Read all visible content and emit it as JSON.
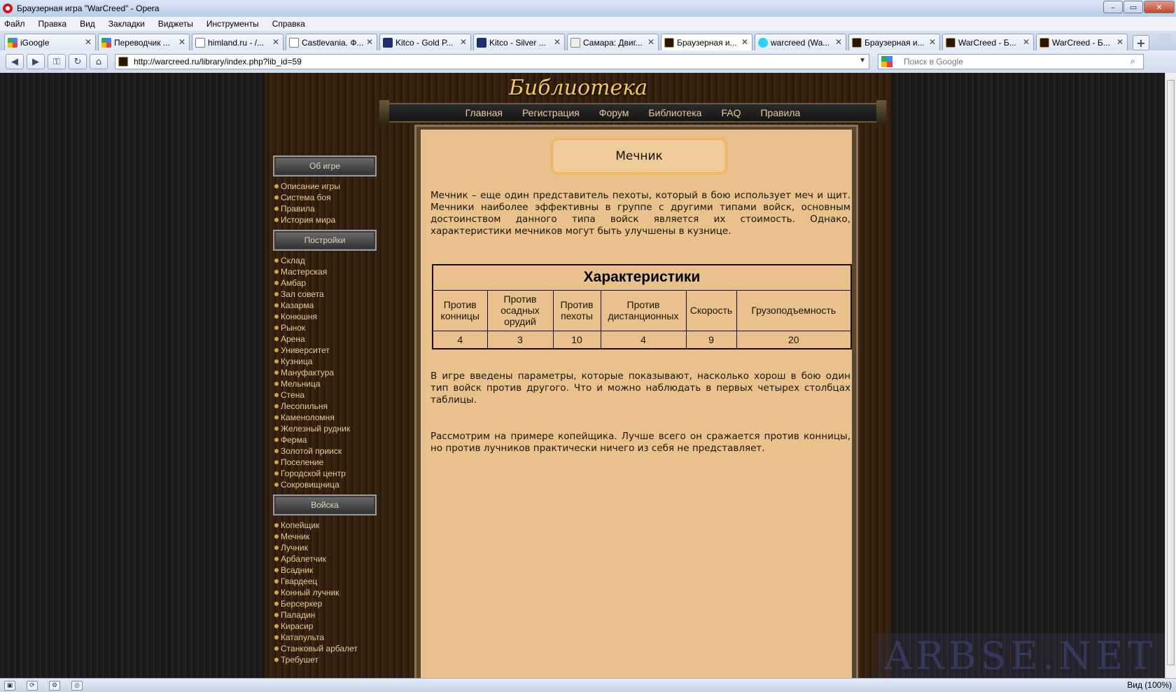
{
  "window": {
    "title": "Браузерная игра \"WarCreed\" - Opera",
    "controls": [
      "–",
      "▭",
      "✕"
    ]
  },
  "menu": [
    "Файл",
    "Правка",
    "Вид",
    "Закладки",
    "Виджеты",
    "Инструменты",
    "Справка"
  ],
  "tabs": [
    {
      "label": "iGoogle",
      "icon": "google-icon"
    },
    {
      "label": "Переводчик ...",
      "icon": "google-icon"
    },
    {
      "label": "himland.ru - /...",
      "icon": "page-icon"
    },
    {
      "label": "Castlevania. Ф...",
      "icon": "page-icon"
    },
    {
      "label": "Kitco - Gold P...",
      "icon": "kitco-icon"
    },
    {
      "label": "Kitco - Silver ...",
      "icon": "kitco-icon"
    },
    {
      "label": "Самара: Двиг...",
      "icon": "page-icon"
    },
    {
      "label": "Браузерная и...",
      "icon": "warcreed-icon",
      "active": true
    },
    {
      "label": "warcreed (Wa...",
      "icon": "twitter-icon"
    },
    {
      "label": "Браузерная и...",
      "icon": "warcreed-icon"
    },
    {
      "label": "WarCreed - Б...",
      "icon": "warcreed-icon"
    },
    {
      "label": "WarCreed - Б...",
      "icon": "warcreed-icon"
    }
  ],
  "address": {
    "url": "http://warcreed.ru/library/index.php?lib_id=59",
    "search_placeholder": "Поиск в Google"
  },
  "site": {
    "title": "Библиотека",
    "nav": [
      "Главная",
      "Регистрация",
      "Форум",
      "Библиотека",
      "FAQ",
      "Правила"
    ]
  },
  "sidebar": {
    "sections": [
      {
        "header": "Об игре",
        "items": [
          "Описание игры",
          "Система боя",
          "Правила",
          "История мира"
        ]
      },
      {
        "header": "Постройки",
        "items": [
          "Склад",
          "Мастерская",
          "Амбар",
          "Зал совета",
          "Казарма",
          "Конюшня",
          "Рынок",
          "Арена",
          "Университет",
          "Кузница",
          "Мануфактура",
          "Мельница",
          "Стена",
          "Лесопильня",
          "Каменоломня",
          "Железный рудник",
          "Ферма",
          "Золотой прииск",
          "Поселение",
          "Городской центр",
          "Сокровищница"
        ]
      },
      {
        "header": "Войска",
        "items": [
          "Копейщик",
          "Мечник",
          "Лучник",
          "Арбалетчик",
          "Всадник",
          "Гвардеец",
          "Конный лучник",
          "Берсеркер",
          "Паладин",
          "Кирасир",
          "Катапульта",
          "Станковый арбалет",
          "Требушет"
        ]
      }
    ]
  },
  "article": {
    "heading": "Мечник",
    "intro": "Мечник – еще один представитель пехоты, который в бою использует меч и щит. Мечники наиболее эффективны в группе с другими типами войск, основным достоинством данного типа войск является их стоимость. Однако, характеристики мечников могут быть улучшены в кузнице.",
    "table": {
      "caption": "Характеристики",
      "headers": [
        "Против конницы",
        "Против осадных орудий",
        "Против пехоты",
        "Против дистанционных",
        "Скорость",
        "Грузоподъемность"
      ],
      "values": [
        "4",
        "3",
        "10",
        "4",
        "9",
        "20"
      ]
    },
    "para2": "В игре введены параметры, которые показывают, насколько хорош в бою один тип войск против другого. Что и можно наблюдать в первых четырех столбцах таблицы.",
    "para3": "Рассмотрим на примере копейщика. Лучше всего он сражается против конницы, но против лучников практически ничего из себя не представляет."
  },
  "watermark": "ARBSE.NET",
  "status": {
    "zoom": "Вид (100%)"
  }
}
